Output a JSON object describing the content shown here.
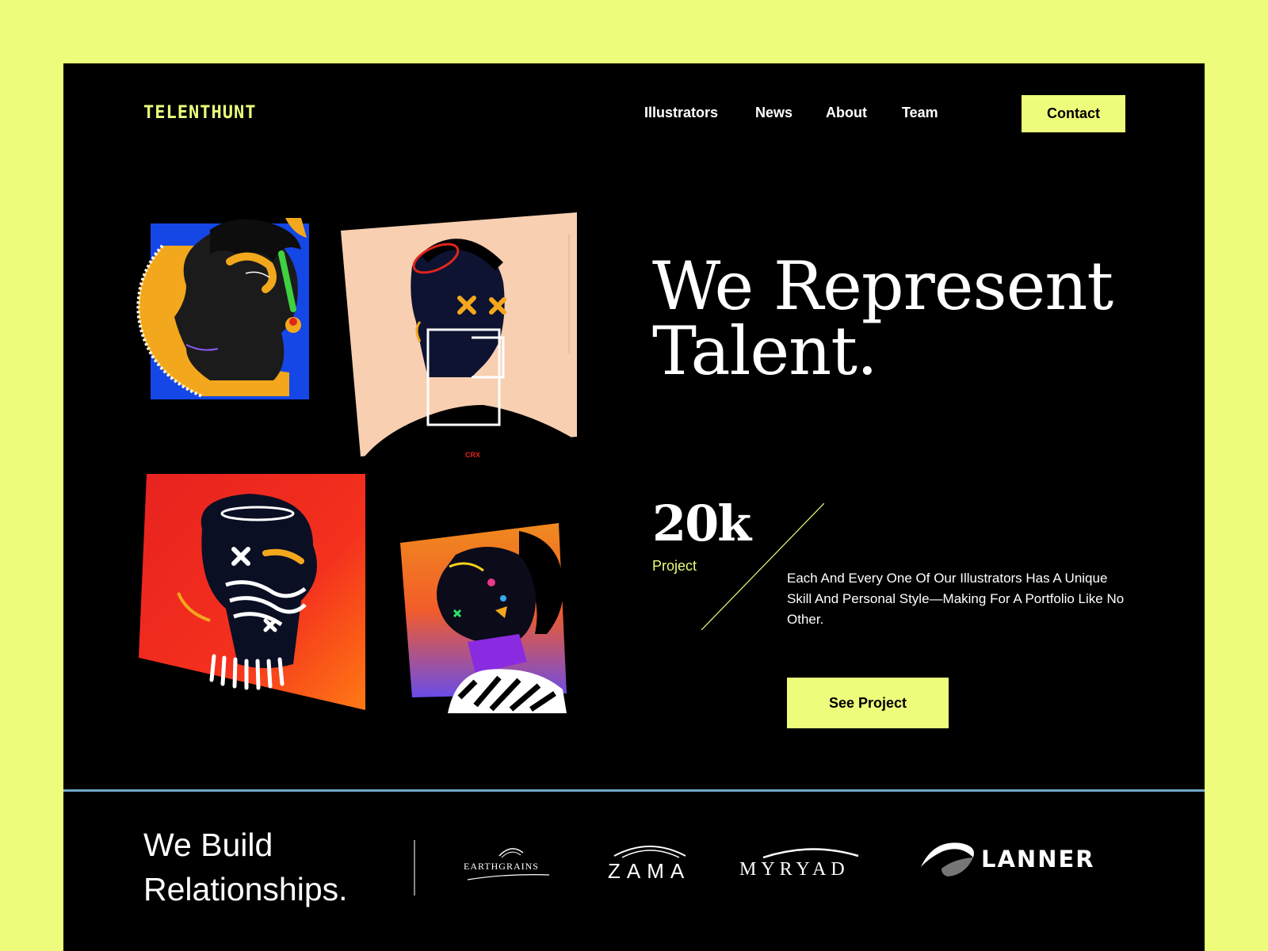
{
  "brand": {
    "logo": "TELENTHUNT"
  },
  "nav": {
    "items": [
      {
        "label": "Illustrators"
      },
      {
        "label": "News"
      },
      {
        "label": "About"
      },
      {
        "label": "Team"
      }
    ],
    "contact_label": "Contact"
  },
  "hero": {
    "title": "We Represent Talent.",
    "stat": {
      "value": "20k",
      "label": "Project"
    },
    "description": "Each And Every One Of Our Illustrators Has A Unique Skill And Personal Style—Making For A Portfolio Like No Other.",
    "cta_label": "See Project",
    "artwork_caption": "CRX"
  },
  "clients": {
    "title": "We Build Relationships.",
    "logos": [
      {
        "name": "EARTHGRAINS"
      },
      {
        "name": "ZAMA"
      },
      {
        "name": "MYRYAD"
      },
      {
        "name": "LANNER"
      }
    ]
  },
  "colors": {
    "accent": "#EDFC7A",
    "background": "#000000",
    "page": "#EDFC7A",
    "divider": "#6EA8C8"
  }
}
